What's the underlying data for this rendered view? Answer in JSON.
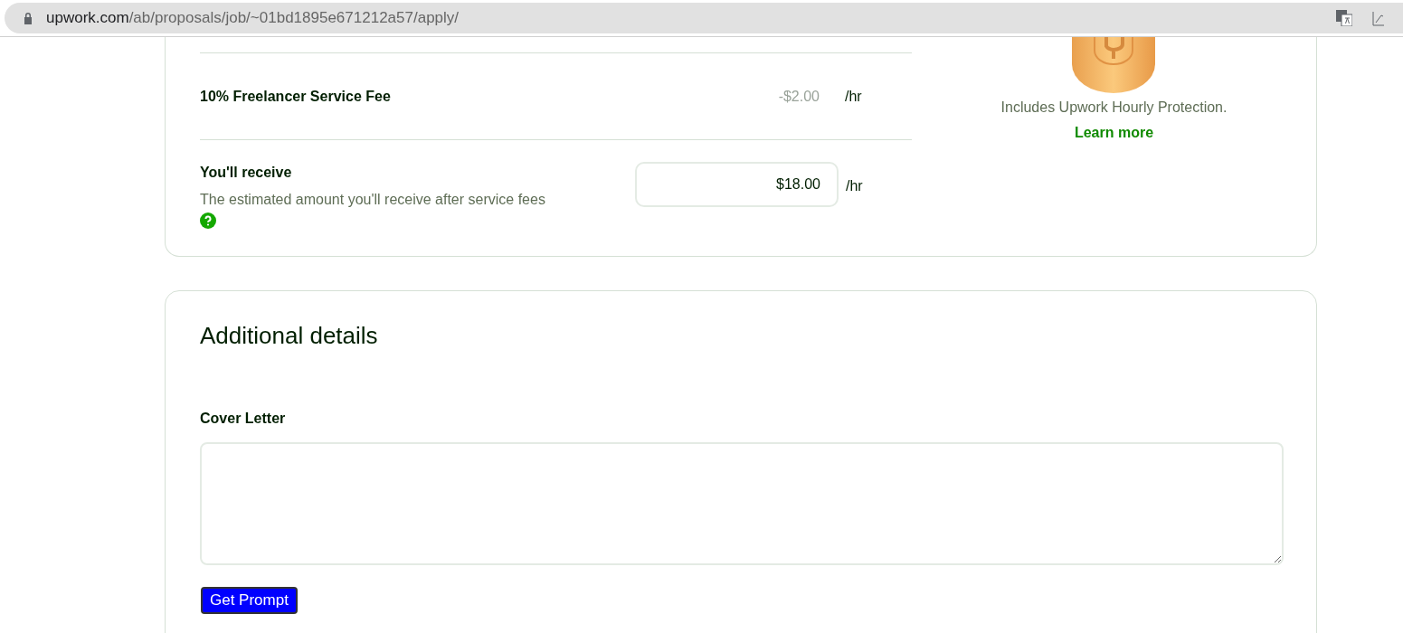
{
  "address_bar": {
    "domain": "upwork.com",
    "path": "/ab/proposals/job/~01bd1895e671212a57/apply/"
  },
  "fee_row": {
    "label": "10% Freelancer Service Fee",
    "amount": "-$2.00",
    "unit": "/hr"
  },
  "receive_row": {
    "label": "You'll receive",
    "description": "The estimated amount you'll receive after service fees",
    "value": "$18.00",
    "unit": "/hr"
  },
  "protection": {
    "text": "Includes Upwork Hourly Protection.",
    "link": "Learn more"
  },
  "additional_details": {
    "title": "Additional details",
    "cover_letter_label": "Cover Letter",
    "button": "Get Prompt"
  }
}
